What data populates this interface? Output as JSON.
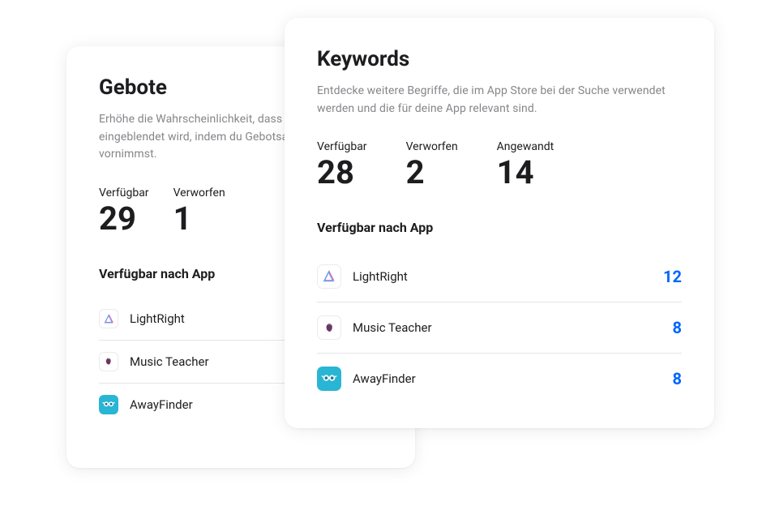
{
  "gebote": {
    "title": "Gebote",
    "description": "Erhöhe die Wahrscheinlichkeit, dass deine Anzeige eingeblendet wird, indem du Gebotsanpassungen vornimmst.",
    "stats": {
      "verfuegbar_label": "Verfügbar",
      "verfuegbar_value": "29",
      "verworfen_label": "Verworfen",
      "verworfen_value": "1"
    },
    "section_label": "Verfügbar nach App",
    "apps": [
      {
        "name": "LightRight"
      },
      {
        "name": "Music Teacher"
      },
      {
        "name": "AwayFinder"
      }
    ]
  },
  "keywords": {
    "title": "Keywords",
    "description": "Entdecke weitere Begriffe, die im App Store bei der Suche verwendet werden und die für deine App relevant sind.",
    "stats": {
      "verfuegbar_label": "Verfügbar",
      "verfuegbar_value": "28",
      "verworfen_label": "Verworfen",
      "verworfen_value": "2",
      "angewandt_label": "Angewandt",
      "angewandt_value": "14"
    },
    "section_label": "Verfügbar nach App",
    "apps": [
      {
        "name": "LightRight",
        "count": "12"
      },
      {
        "name": "Music Teacher",
        "count": "8"
      },
      {
        "name": "AwayFinder",
        "count": "8"
      }
    ]
  }
}
